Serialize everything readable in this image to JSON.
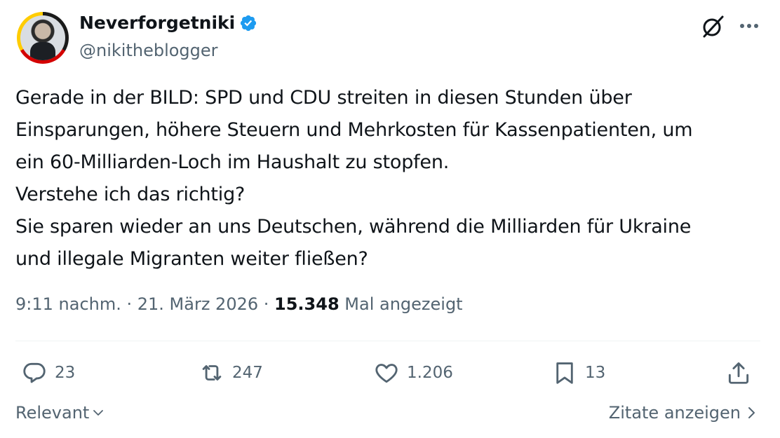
{
  "author": {
    "display_name": "Neverforgetniki",
    "handle": "@nikitheblogger",
    "verified": true
  },
  "tweet": {
    "text": "Gerade in der BILD: SPD und CDU streiten in diesen Stunden über\nEinsparungen, höhere Steuern und Mehrkosten für Kassenpatienten, um\nein 60-Milliarden-Loch im Haushalt zu stopfen.\nVerstehe ich das richtig?\nSie sparen wieder an uns Deutschen, während die Milliarden für Ukraine\nund illegale Migranten weiter fließen?",
    "time": "9:11 nachm.",
    "separator": " · ",
    "date": "21. März 2026",
    "views_count": "15.348",
    "views_label": " Mal angezeigt"
  },
  "actions": {
    "replies": "23",
    "retweets": "247",
    "likes": "1.206",
    "bookmarks": "13"
  },
  "footer": {
    "sort_label": "Relevant",
    "quotes_label": "Zitate anzeigen"
  },
  "colors": {
    "text": "#0f1419",
    "secondary": "#536471",
    "verified": "#1d9bf0",
    "divider": "#eff3f4"
  },
  "icons": [
    "verified-badge-icon",
    "grok-icon",
    "more-icon",
    "reply-icon",
    "retweet-icon",
    "like-icon",
    "bookmark-icon",
    "share-icon",
    "chevron-down-icon",
    "chevron-right-icon"
  ]
}
